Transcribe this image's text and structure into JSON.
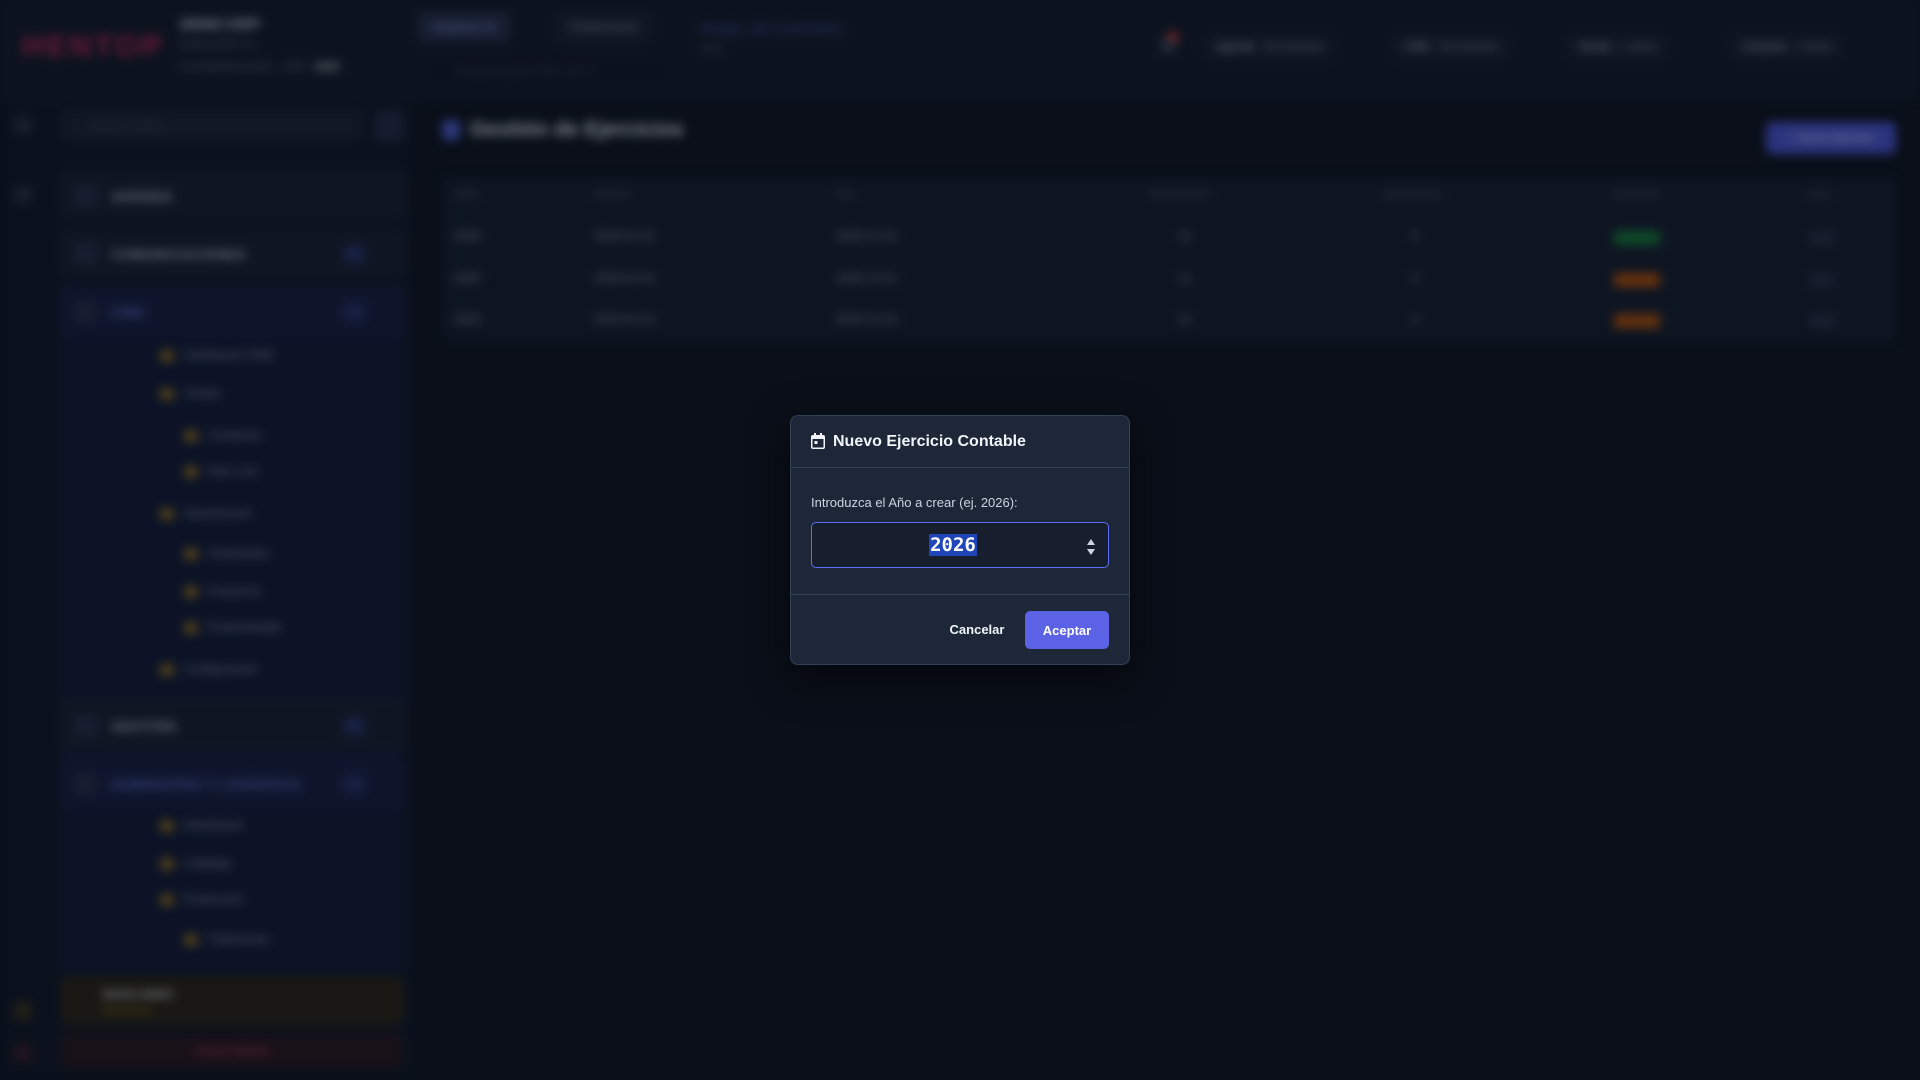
{
  "app": {
    "logo": "HENTOP",
    "company_name": "DEMO ERP",
    "company_sub": "DEMO ERP S.L.",
    "company_meta": "Contabilidad Activa · AÑO",
    "active_year": "2026",
    "tab_ai": "Asistente IA",
    "tab_prefs": "Preferencias",
    "global_search_placeholder": "Búsqueda global (⌘+Ctrl+K)",
    "panel_title": "PANEL DE CONTROL",
    "panel_sub": "Inicio"
  },
  "header_chips": [
    {
      "label": "Agenda",
      "value": "Sin Eventos"
    },
    {
      "label": "CRM",
      "value": "Sin Eventos"
    },
    {
      "label": "Ventas",
      "value": "1 tarea"
    },
    {
      "label": "Compras",
      "value": "1 tarea"
    }
  ],
  "sidebar": {
    "search_placeholder": "Buscar módulo...",
    "sections": {
      "agenda": "AGENDA",
      "comunicaciones": "COMUNICACIONES",
      "crm": "CRM",
      "gestion": "GESTIÓN",
      "fabricacion": "SUMINISTRO Y LOGÍSTICA"
    },
    "crm_items": [
      "Dashboard CRM",
      "Ventas",
      "Contactos",
      "Pipe Line",
      "Operaciones",
      "Actividades",
      "Proyectos",
      "Productividad",
      "Configuración"
    ],
    "fab_items": [
      "Dashboard",
      "Catálogo",
      "Producción",
      "Fabricación"
    ],
    "demo_title": "MODO DEMO",
    "demo_sub": "Solo lectura",
    "logout": "Cerrar Sesión"
  },
  "main": {
    "title": "Gestión de Ejercicios",
    "new_button": "+ Nuevo Ejercicio",
    "columns": [
      "AÑO",
      "INICIO",
      "FIN",
      "PERIODOS",
      "ASIENTOS",
      "ESTADO",
      "ACC."
    ],
    "rows": [
      {
        "year": "2026",
        "start": "2026-01-01",
        "end": "2026-12-31",
        "periods": "12",
        "entries": "0",
        "status": "Abierto",
        "status_color": "#15803d"
      },
      {
        "year": "2025",
        "start": "2025-01-01",
        "end": "2025-12-31",
        "periods": "12",
        "entries": "0",
        "status": "Cerrado",
        "status_color": "#b45309"
      },
      {
        "year": "2024",
        "start": "2024-01-01",
        "end": "2024-12-31",
        "periods": "12",
        "entries": "0",
        "status": "Cerrado",
        "status_color": "#b45309"
      }
    ]
  },
  "modal": {
    "icon": "calendar-icon",
    "title": "Nuevo Ejercicio Contable",
    "label": "Introduzca el Año a crear (ej. 2026):",
    "input_value": "2026",
    "cancel": "Cancelar",
    "accept": "Aceptar"
  },
  "colors": {
    "accent": "#5b62e6",
    "input_border": "#5b6ef5",
    "selection": "#1f45b8",
    "modal_bg": "#1e2738"
  }
}
